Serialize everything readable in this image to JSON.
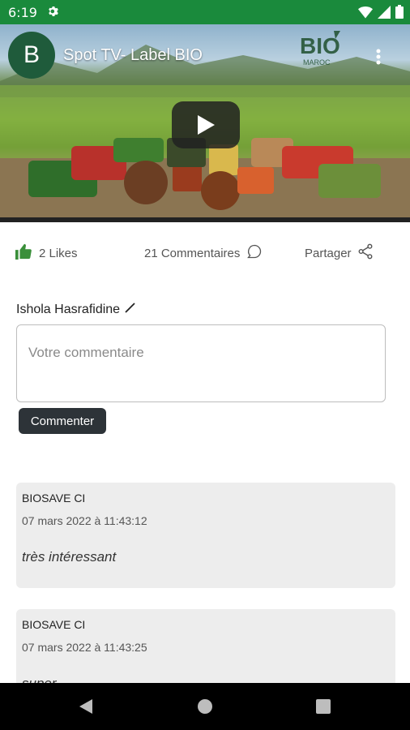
{
  "status_bar": {
    "time": "6:19"
  },
  "video": {
    "channel_initial": "B",
    "title": "Spot TV- Label BIO"
  },
  "actions": {
    "likes": "2 Likes",
    "comments": "21 Commentaires",
    "share": "Partager"
  },
  "comment_form": {
    "author": "Ishola Hasrafidine",
    "placeholder": "Votre commentaire",
    "value": "",
    "submit_label": "Commenter"
  },
  "comments": [
    {
      "author": "BIOSAVE CI",
      "date": "07 mars 2022 à 11:43:12",
      "text": "très intéressant"
    },
    {
      "author": "BIOSAVE CI",
      "date": "07 mars 2022 à 11:43:25",
      "text": "super"
    }
  ],
  "colors": {
    "status_bar": "#1a8a3c",
    "like_icon": "#3a8f3a",
    "button": "#2d3338",
    "card_bg": "#ededed"
  }
}
